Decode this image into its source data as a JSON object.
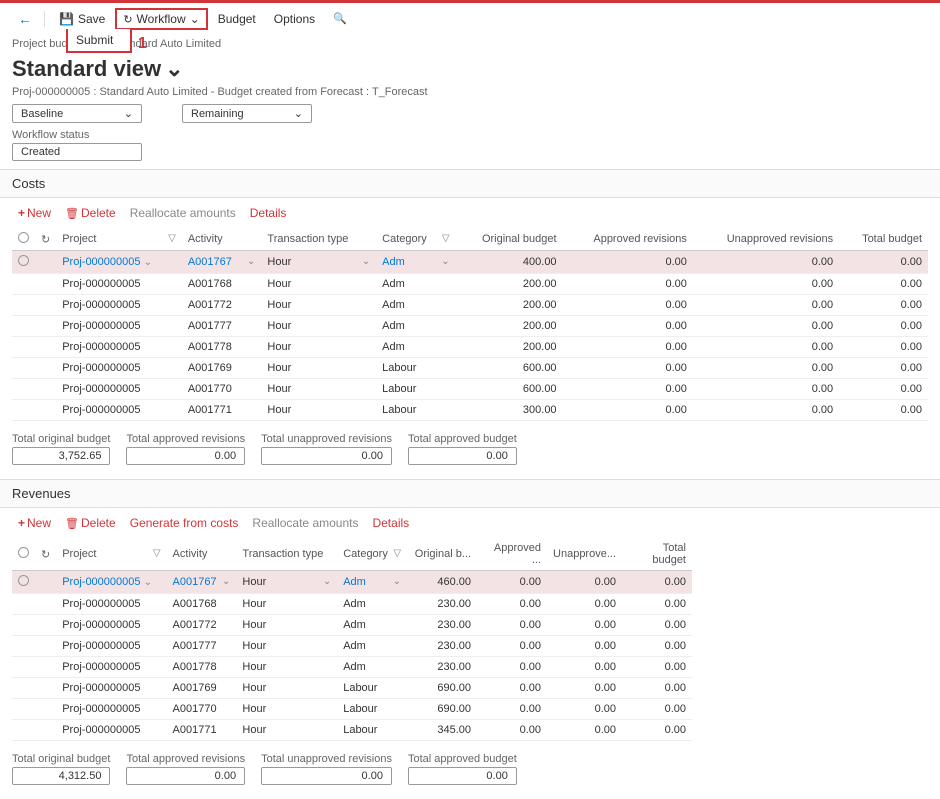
{
  "topbar": {
    "save": "Save",
    "workflow": "Workflow",
    "submit": "Submit",
    "budget": "Budget",
    "options": "Options"
  },
  "annotation": "1",
  "breadcrumb": "Project budgets          05 : Standard Auto Limited",
  "title": "Standard view",
  "subtitle": "Proj-000000005 : Standard Auto Limited - Budget created from Forecast : T_Forecast",
  "baseline": "Baseline",
  "remaining": "Remaining",
  "workflow_status_label": "Workflow status",
  "workflow_status": "Created",
  "costs": {
    "header": "Costs",
    "toolbar": {
      "new": "New",
      "delete": "Delete",
      "reallocate": "Reallocate amounts",
      "details": "Details"
    },
    "cols": {
      "project": "Project",
      "activity": "Activity",
      "txn": "Transaction type",
      "category": "Category",
      "orig": "Original budget",
      "appr": "Approved revisions",
      "unappr": "Unapproved revisions",
      "total": "Total budget"
    },
    "rows": [
      {
        "project": "Proj-000000005",
        "activity": "A001767",
        "txn": "Hour",
        "category": "Adm",
        "orig": "400.00",
        "appr": "0.00",
        "unappr": "0.00",
        "total": "0.00",
        "selected": true
      },
      {
        "project": "Proj-000000005",
        "activity": "A001768",
        "txn": "Hour",
        "category": "Adm",
        "orig": "200.00",
        "appr": "0.00",
        "unappr": "0.00",
        "total": "0.00"
      },
      {
        "project": "Proj-000000005",
        "activity": "A001772",
        "txn": "Hour",
        "category": "Adm",
        "orig": "200.00",
        "appr": "0.00",
        "unappr": "0.00",
        "total": "0.00"
      },
      {
        "project": "Proj-000000005",
        "activity": "A001777",
        "txn": "Hour",
        "category": "Adm",
        "orig": "200.00",
        "appr": "0.00",
        "unappr": "0.00",
        "total": "0.00"
      },
      {
        "project": "Proj-000000005",
        "activity": "A001778",
        "txn": "Hour",
        "category": "Adm",
        "orig": "200.00",
        "appr": "0.00",
        "unappr": "0.00",
        "total": "0.00"
      },
      {
        "project": "Proj-000000005",
        "activity": "A001769",
        "txn": "Hour",
        "category": "Labour",
        "orig": "600.00",
        "appr": "0.00",
        "unappr": "0.00",
        "total": "0.00"
      },
      {
        "project": "Proj-000000005",
        "activity": "A001770",
        "txn": "Hour",
        "category": "Labour",
        "orig": "600.00",
        "appr": "0.00",
        "unappr": "0.00",
        "total": "0.00"
      },
      {
        "project": "Proj-000000005",
        "activity": "A001771",
        "txn": "Hour",
        "category": "Labour",
        "orig": "300.00",
        "appr": "0.00",
        "unappr": "0.00",
        "total": "0.00"
      }
    ],
    "totals": {
      "labels": {
        "orig": "Total original budget",
        "appr": "Total approved revisions",
        "unappr": "Total unapproved revisions",
        "approved": "Total approved budget"
      },
      "orig": "3,752.65",
      "appr": "0.00",
      "unappr": "0.00",
      "approved": "0.00"
    }
  },
  "revenues": {
    "header": "Revenues",
    "toolbar": {
      "new": "New",
      "delete": "Delete",
      "generate": "Generate from costs",
      "reallocate": "Reallocate amounts",
      "details": "Details"
    },
    "cols": {
      "project": "Project",
      "activity": "Activity",
      "txn": "Transaction type",
      "category": "Category",
      "orig": "Original b...",
      "appr": "Approved ...",
      "unappr": "Unapprove...",
      "total": "Total budget"
    },
    "rows": [
      {
        "project": "Proj-000000005",
        "activity": "A001767",
        "txn": "Hour",
        "category": "Adm",
        "orig": "460.00",
        "appr": "0.00",
        "unappr": "0.00",
        "total": "0.00",
        "selected": true
      },
      {
        "project": "Proj-000000005",
        "activity": "A001768",
        "txn": "Hour",
        "category": "Adm",
        "orig": "230.00",
        "appr": "0.00",
        "unappr": "0.00",
        "total": "0.00"
      },
      {
        "project": "Proj-000000005",
        "activity": "A001772",
        "txn": "Hour",
        "category": "Adm",
        "orig": "230.00",
        "appr": "0.00",
        "unappr": "0.00",
        "total": "0.00"
      },
      {
        "project": "Proj-000000005",
        "activity": "A001777",
        "txn": "Hour",
        "category": "Adm",
        "orig": "230.00",
        "appr": "0.00",
        "unappr": "0.00",
        "total": "0.00"
      },
      {
        "project": "Proj-000000005",
        "activity": "A001778",
        "txn": "Hour",
        "category": "Adm",
        "orig": "230.00",
        "appr": "0.00",
        "unappr": "0.00",
        "total": "0.00"
      },
      {
        "project": "Proj-000000005",
        "activity": "A001769",
        "txn": "Hour",
        "category": "Labour",
        "orig": "690.00",
        "appr": "0.00",
        "unappr": "0.00",
        "total": "0.00"
      },
      {
        "project": "Proj-000000005",
        "activity": "A001770",
        "txn": "Hour",
        "category": "Labour",
        "orig": "690.00",
        "appr": "0.00",
        "unappr": "0.00",
        "total": "0.00"
      },
      {
        "project": "Proj-000000005",
        "activity": "A001771",
        "txn": "Hour",
        "category": "Labour",
        "orig": "345.00",
        "appr": "0.00",
        "unappr": "0.00",
        "total": "0.00"
      }
    ],
    "totals": {
      "labels": {
        "orig": "Total original budget",
        "appr": "Total approved revisions",
        "unappr": "Total unapproved revisions",
        "approved": "Total approved budget"
      },
      "orig": "4,312.50",
      "appr": "0.00",
      "unappr": "0.00",
      "approved": "0.00"
    }
  }
}
